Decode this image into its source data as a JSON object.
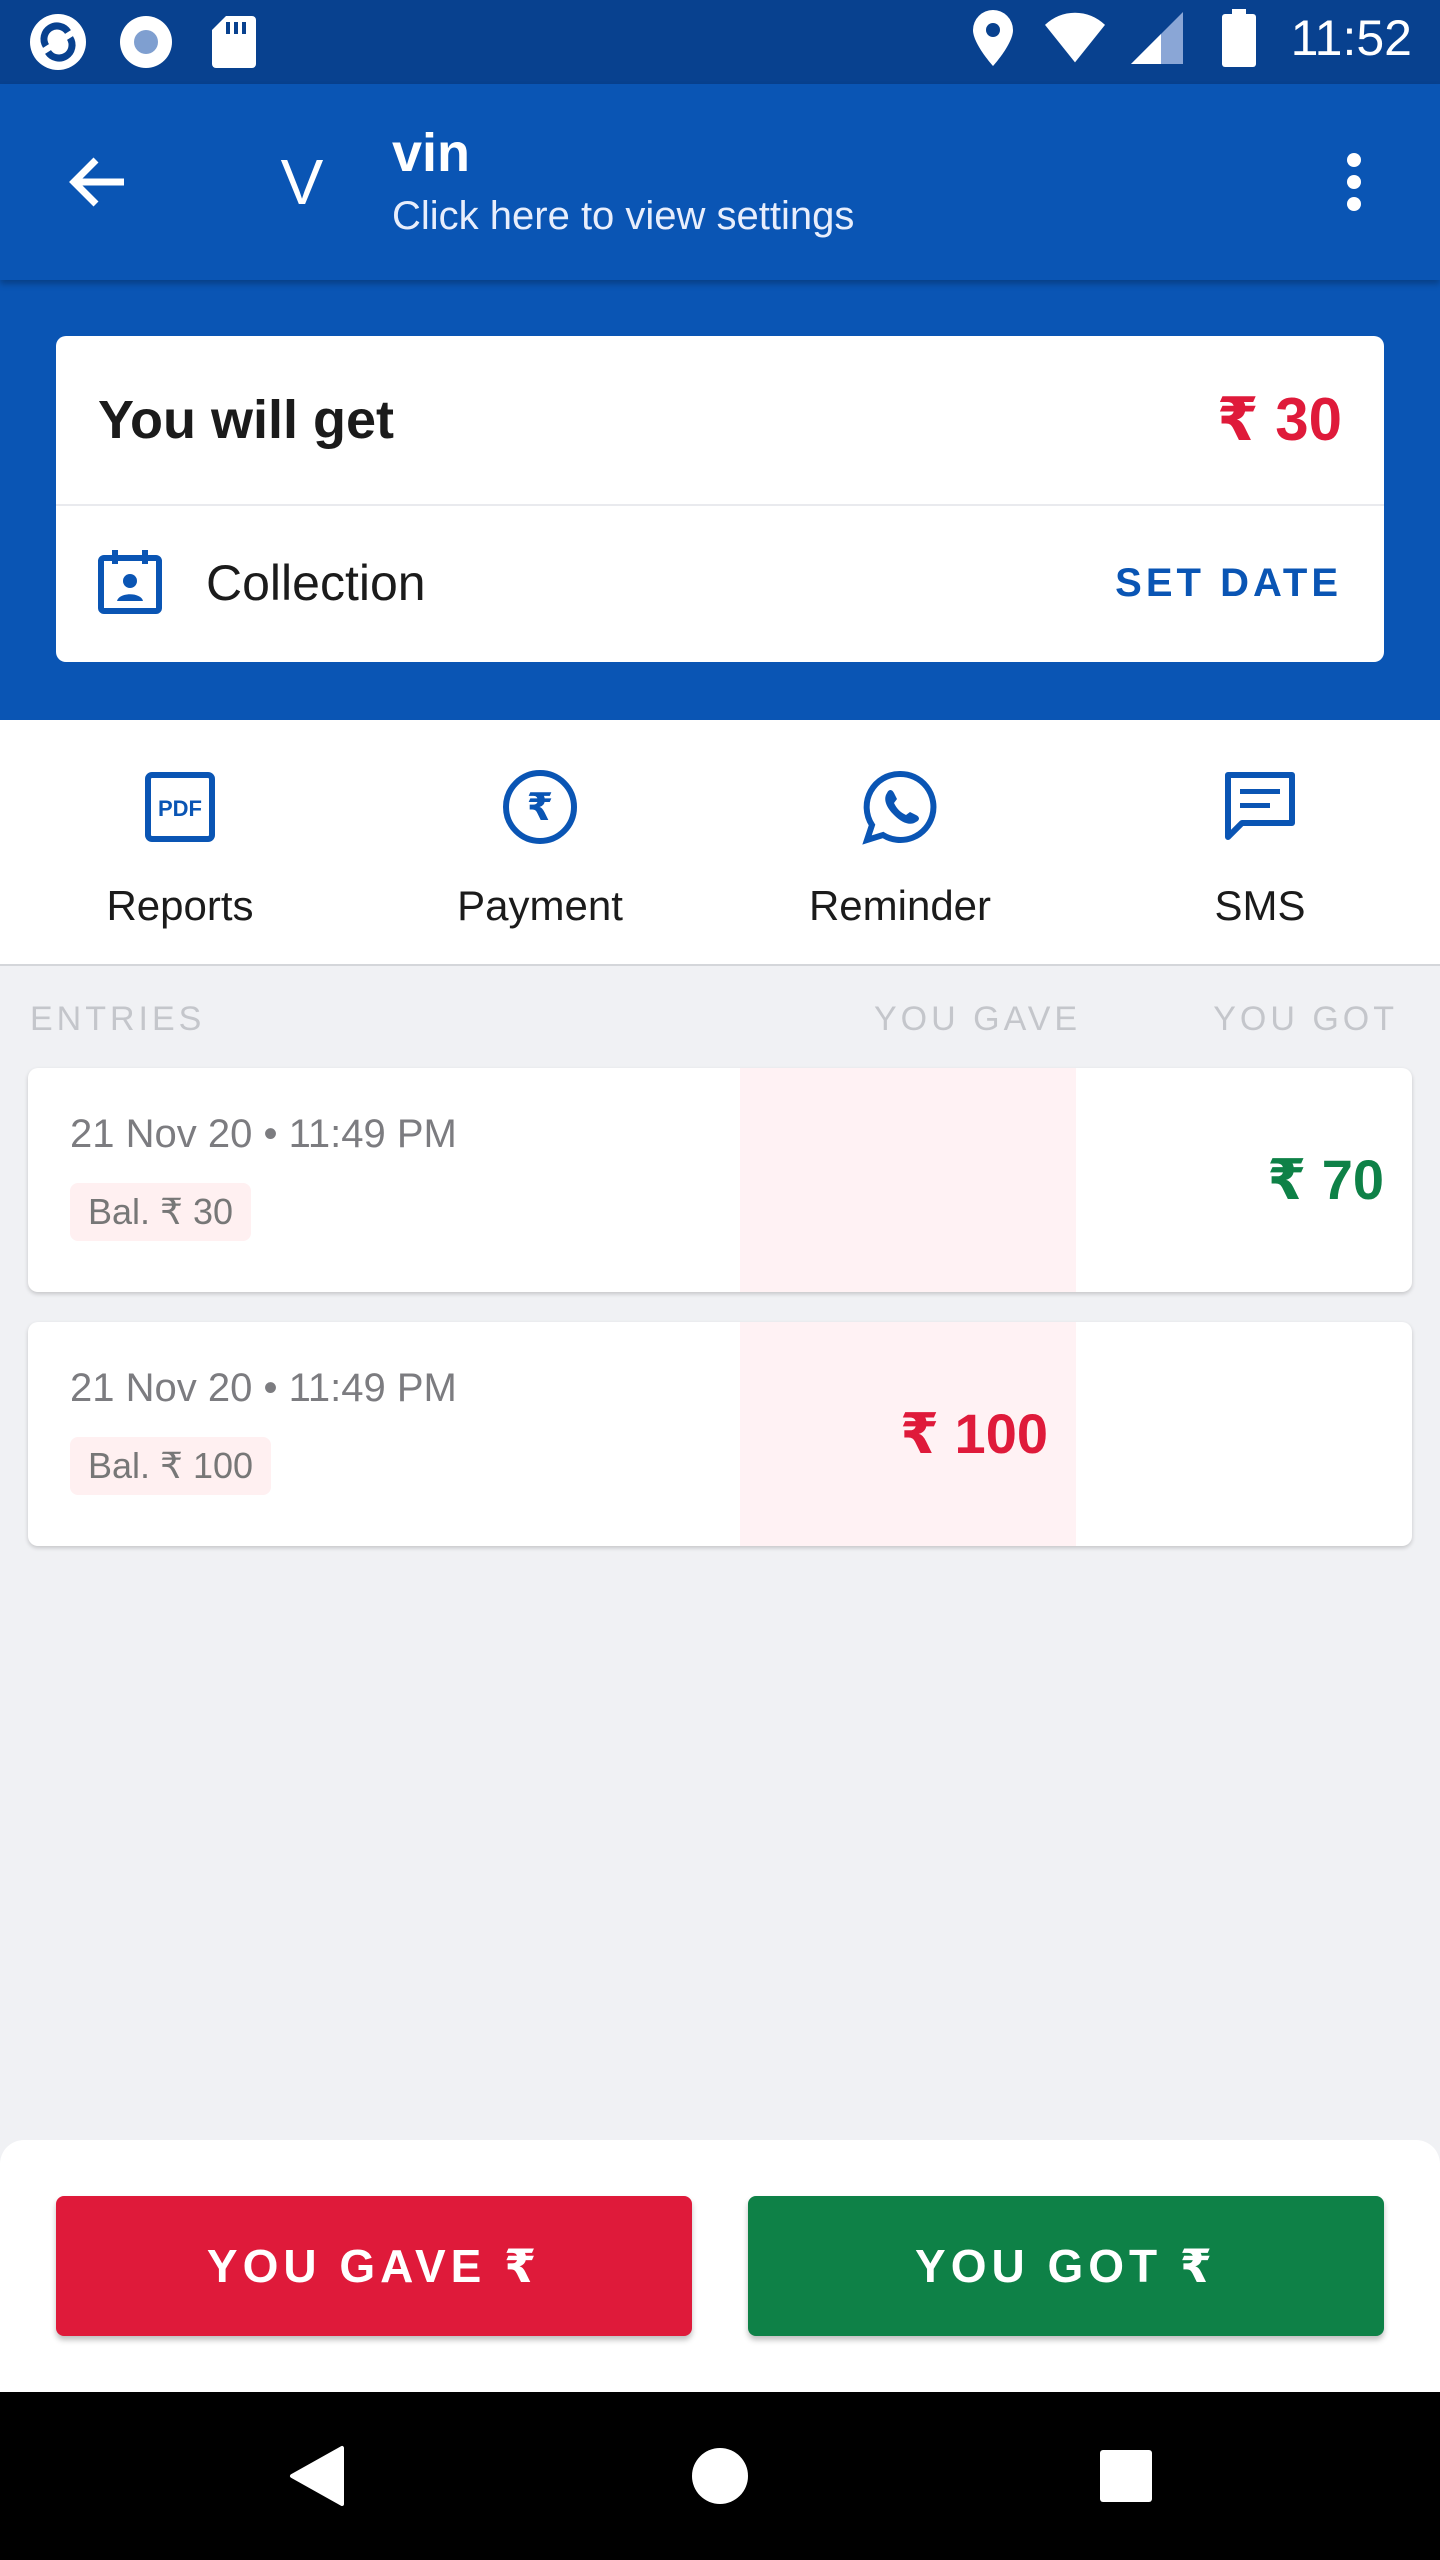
{
  "status_bar": {
    "time": "11:52",
    "left_icons": [
      "app-notification-icon",
      "record-icon",
      "sd-card-icon"
    ],
    "right_icons": [
      "location-icon",
      "wifi-icon",
      "signal-icon",
      "battery-icon"
    ]
  },
  "header": {
    "avatar_letter": "V",
    "contact_name": "vin",
    "subtitle": "Click here to view settings"
  },
  "summary": {
    "label": "You will get",
    "amount": "₹ 30",
    "collection_label": "Collection",
    "set_date_label": "SET DATE"
  },
  "actions": [
    {
      "label": "Reports",
      "icon": "pdf-icon"
    },
    {
      "label": "Payment",
      "icon": "rupee-circle-icon"
    },
    {
      "label": "Reminder",
      "icon": "whatsapp-icon"
    },
    {
      "label": "SMS",
      "icon": "message-icon"
    }
  ],
  "entries_header": {
    "entries": "ENTRIES",
    "you_gave": "YOU GAVE",
    "you_got": "YOU GOT"
  },
  "entries": [
    {
      "date": "21 Nov 20 • 11:49 PM",
      "balance": "Bal. ₹ 30",
      "gave": "",
      "got": "₹ 70"
    },
    {
      "date": "21 Nov 20 • 11:49 PM",
      "balance": "Bal. ₹ 100",
      "gave": "₹ 100",
      "got": ""
    }
  ],
  "buttons": {
    "you_gave": "YOU GAVE ₹",
    "you_got": "YOU GOT ₹"
  },
  "colors": {
    "primary": "#0a55b4",
    "gave_red": "#df1a3a",
    "got_green": "#0e8147"
  }
}
